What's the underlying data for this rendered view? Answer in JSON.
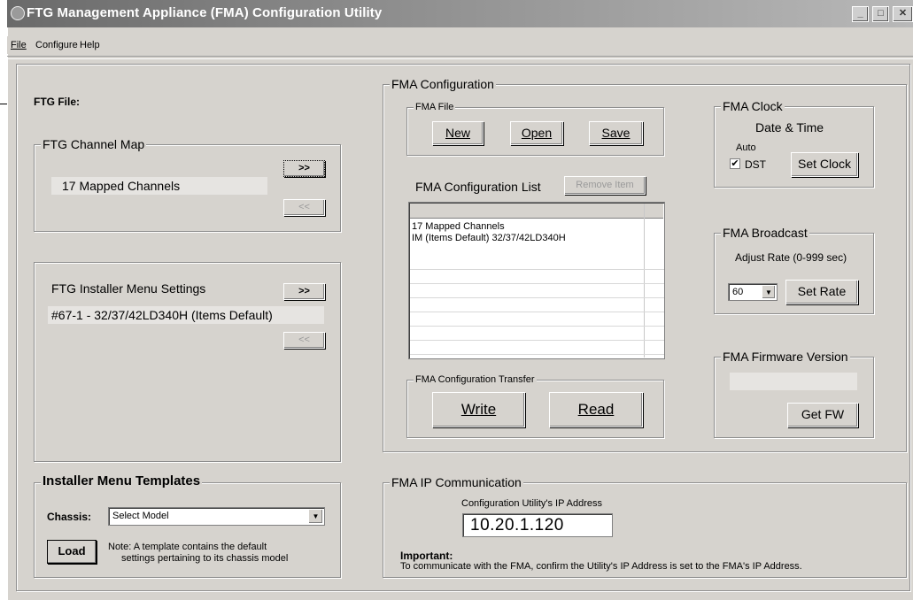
{
  "window": {
    "title": "FTG Management Appliance (FMA) Configuration Utility"
  },
  "menu": [
    "File",
    "Configure",
    "Help"
  ],
  "ftg_file": {
    "label": "FTG File:"
  },
  "channel_map": {
    "title": "FTG Channel Map",
    "value": "17 Mapped Channels",
    "add": ">>",
    "remove": "<<"
  },
  "installer_menu": {
    "title": "FTG Installer Menu Settings",
    "value": "#67-1 - 32/37/42LD340H (Items Default)",
    "add": ">>",
    "remove": "<<"
  },
  "templates": {
    "title": "Installer Menu Templates",
    "chassis_label": "Chassis:",
    "chassis_value": "Select Model",
    "load": "Load",
    "note_line1": "Note:  A template contains the default",
    "note_line2": "settings pertaining to its chassis model"
  },
  "fma_config": {
    "title": "FMA Configuration",
    "file_title": "FMA File",
    "new": "New",
    "open": "Open",
    "save": "Save",
    "list_label": "FMA Configuration List",
    "remove_item": "Remove Item",
    "list_items": [
      "17 Mapped Channels",
      "IM (Items Default) 32/37/42LD340H"
    ],
    "transfer_title": "FMA Configuration Transfer",
    "write": "Write",
    "read": "Read"
  },
  "clock": {
    "title": "FMA Clock",
    "subtitle": "Date & Time",
    "auto": "Auto",
    "dst": "DST",
    "dst_checked": true,
    "set": "Set Clock"
  },
  "broadcast": {
    "title": "FMA Broadcast",
    "label": "Adjust Rate (0-999 sec)",
    "rate": "60",
    "set": "Set Rate"
  },
  "firmware": {
    "title": "FMA Firmware Version",
    "value": "",
    "get": "Get FW"
  },
  "ip": {
    "title": "FMA IP Communication",
    "label": "Configuration Utility's IP Address",
    "address": "10.20.1.120",
    "important": "Important:",
    "note": "To communicate with the FMA, confirm the Utility's IP Address is set to the FMA's IP Address."
  }
}
